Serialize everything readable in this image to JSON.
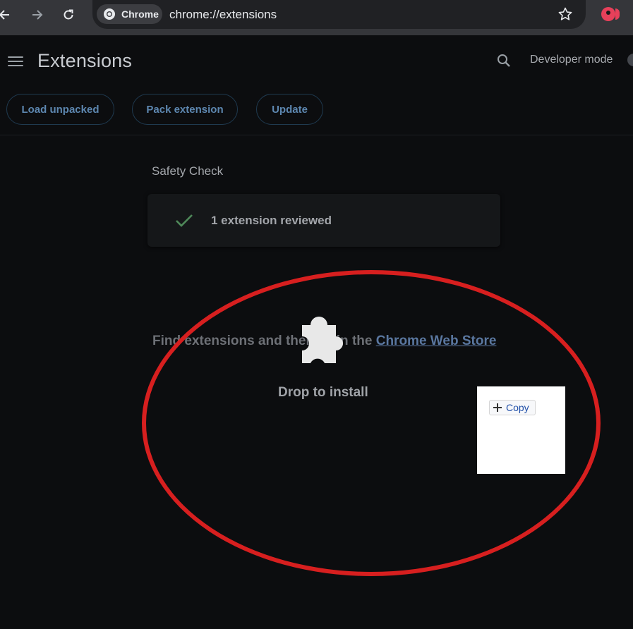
{
  "browser": {
    "site_chip_label": "Chrome",
    "url": "chrome://extensions"
  },
  "header": {
    "title": "Extensions",
    "developer_mode_label": "Developer mode"
  },
  "toolbar": {
    "load_unpacked": "Load unpacked",
    "pack_extension": "Pack extension",
    "update": "Update"
  },
  "safety_check": {
    "heading": "Safety Check",
    "status": "1 extension reviewed"
  },
  "empty_state": {
    "find_prefix": "Find extensions and themes in the",
    "link_text": "Chrome Web Store"
  },
  "drop_overlay": {
    "message": "Drop to install"
  },
  "copy_panel": {
    "copy_label": "Copy"
  },
  "colors": {
    "background": "#0c0d0f",
    "accent_blue": "#5d87b0",
    "check_green": "#4f8a5a",
    "annotation_red": "#d71f1f"
  }
}
